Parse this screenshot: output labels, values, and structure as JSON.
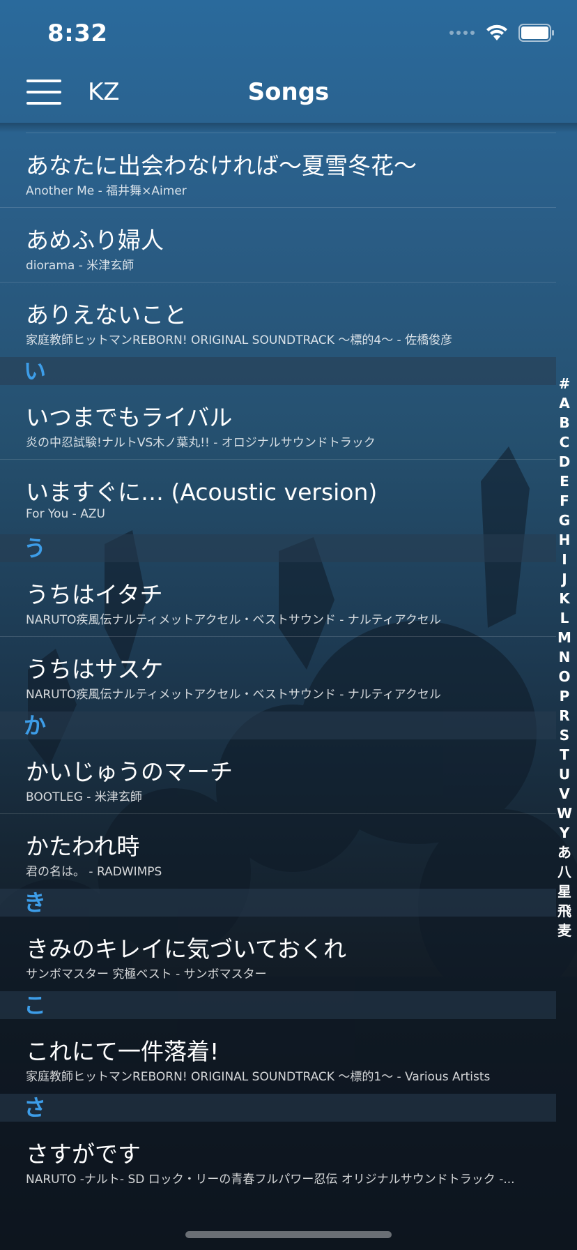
{
  "status": {
    "time": "8:32"
  },
  "nav": {
    "left_label": "KZ",
    "title": "Songs"
  },
  "first_rows": [
    {
      "title": "あなたに出会わなければ〜夏雪冬花〜",
      "subtitle": "Another Me - 福井舞×Aimer"
    },
    {
      "title": "あめふり婦人",
      "subtitle": "diorama - 米津玄師"
    },
    {
      "title": "ありえないこと",
      "subtitle": "家庭教師ヒットマンREBORN! ORIGINAL SOUNDTRACK 〜標的4〜 - 佐橋俊彦"
    }
  ],
  "sections": [
    {
      "header": "い",
      "rows": [
        {
          "title": "いつまでもライバル",
          "subtitle": "炎の中忍試験!ナルトVS木ノ葉丸!! - オロジナルサウンドトラック"
        },
        {
          "title": "いますぐに… (Acoustic version)",
          "subtitle": "For You - AZU"
        }
      ]
    },
    {
      "header": "う",
      "rows": [
        {
          "title": "うちはイタチ",
          "subtitle": "NARUTO疾風伝ナルティメットアクセル・ベストサウンド - ナルティアクセル"
        },
        {
          "title": "うちはサスケ",
          "subtitle": "NARUTO疾風伝ナルティメットアクセル・ベストサウンド - ナルティアクセル"
        }
      ]
    },
    {
      "header": "か",
      "rows": [
        {
          "title": "かいじゅうのマーチ",
          "subtitle": "BOOTLEG - 米津玄師"
        },
        {
          "title": "かたわれ時",
          "subtitle": "君の名は。 - RADWIMPS"
        }
      ]
    },
    {
      "header": "き",
      "rows": [
        {
          "title": "きみのキレイに気づいておくれ",
          "subtitle": "サンボマスター 究極ベスト - サンボマスター"
        }
      ]
    },
    {
      "header": "こ",
      "rows": [
        {
          "title": "これにて一件落着!",
          "subtitle": "家庭教師ヒットマンREBORN! ORIGINAL SOUNDTRACK 〜標的1〜 - Various Artists"
        }
      ]
    },
    {
      "header": "さ",
      "rows": [
        {
          "title": "さすがです",
          "subtitle": "NARUTO -ナルト- SD ロック・リーの青春フルパワー忍伝 オリジナルサウンドトラック -..."
        }
      ]
    }
  ],
  "index": [
    "#",
    "A",
    "B",
    "C",
    "D",
    "E",
    "F",
    "G",
    "H",
    "I",
    "J",
    "K",
    "L",
    "M",
    "N",
    "O",
    "P",
    "R",
    "S",
    "T",
    "U",
    "V",
    "W",
    "Y",
    "あ",
    "八",
    "星",
    "飛",
    "麦"
  ],
  "colors": {
    "accent": "#3d9de8",
    "nav_bg": "#2a6a9c"
  },
  "icons": [
    "menu-icon",
    "cellular-signal-icon",
    "wifi-icon",
    "battery-icon"
  ]
}
